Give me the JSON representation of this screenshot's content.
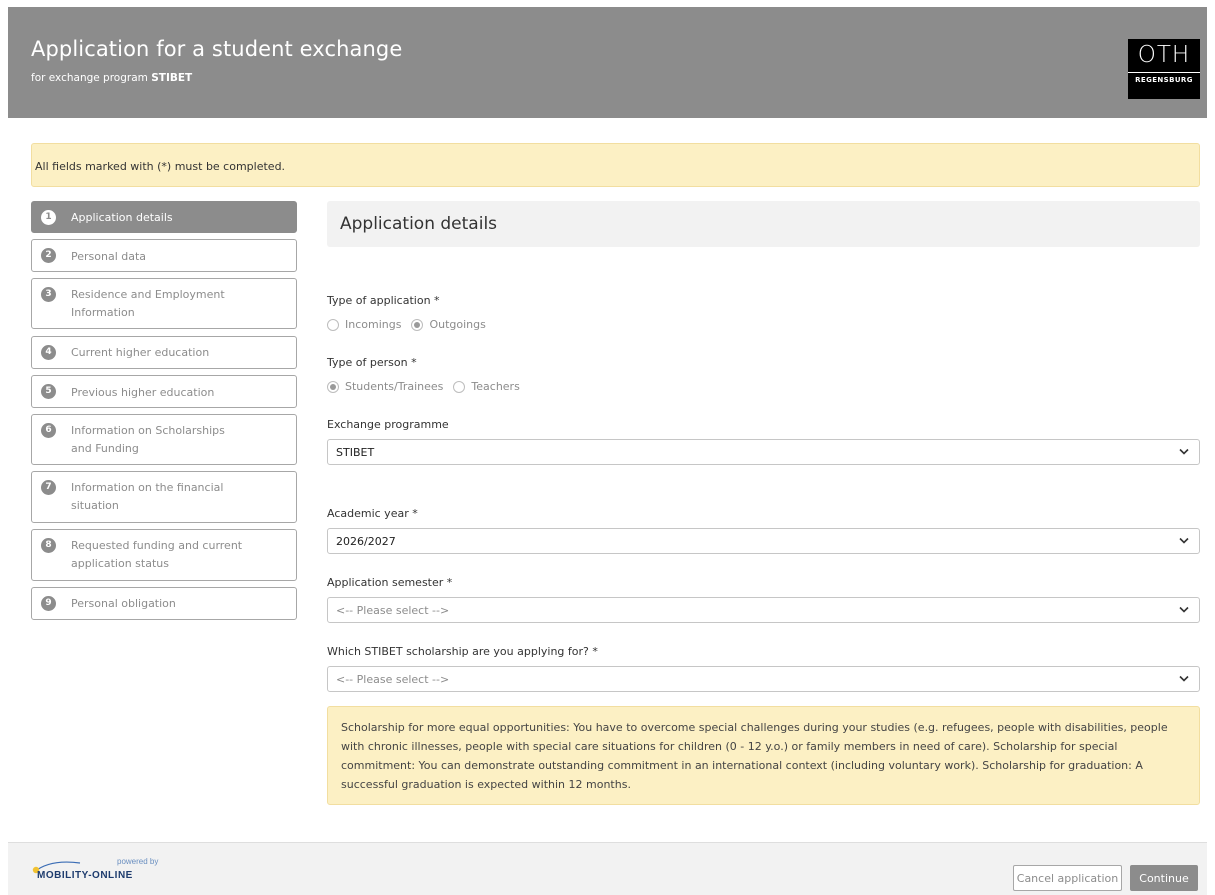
{
  "header": {
    "title": "Application for a student exchange",
    "subtitle_prefix": "for exchange program ",
    "subtitle_program": "STIBET",
    "logo_main": "OTH",
    "logo_sub": "REGENSBURG"
  },
  "notice": "All fields marked with (*) must be completed.",
  "steps": [
    {
      "num": "1",
      "label": "Application details",
      "active": true
    },
    {
      "num": "2",
      "label": "Personal data"
    },
    {
      "num": "3",
      "label_line1": "Residence and Employment",
      "label_line2": "Information"
    },
    {
      "num": "4",
      "label": "Current higher education"
    },
    {
      "num": "5",
      "label": "Previous higher education"
    },
    {
      "num": "6",
      "label_line1": "Information on Scholarships",
      "label_line2": "and Funding"
    },
    {
      "num": "7",
      "label_line1": "Information on the financial",
      "label_line2": "situation"
    },
    {
      "num": "8",
      "label_line1": "Requested funding and current",
      "label_line2": "application status"
    },
    {
      "num": "9",
      "label": "Personal obligation"
    }
  ],
  "panel_title": "Application details",
  "form": {
    "type_of_application": {
      "label": "Type of application *",
      "options": [
        {
          "label": "Incomings",
          "checked": false
        },
        {
          "label": "Outgoings",
          "checked": true
        }
      ]
    },
    "type_of_person": {
      "label": "Type of person *",
      "options": [
        {
          "label": "Students/Trainees",
          "checked": true
        },
        {
          "label": "Teachers",
          "checked": false
        }
      ]
    },
    "exchange_programme": {
      "label": "Exchange programme",
      "value": "STIBET"
    },
    "academic_year": {
      "label": "Academic year *",
      "value": "2026/2027"
    },
    "application_semester": {
      "label": "Application semester *",
      "value": "<-- Please select -->"
    },
    "scholarship": {
      "label": "Which STIBET scholarship are you applying for? *",
      "value": "<-- Please select -->"
    }
  },
  "info_text": "Scholarship for more equal opportunities: You have to overcome special challenges during your studies (e.g. refugees, people with disabilities, people with chronic illnesses, people with special care situations for children (0 - 12 y.o.) or family members in need of care). Scholarship for special commitment: You can demonstrate outstanding commitment in an international context (including voluntary work). Scholarship for graduation: A successful graduation is expected within 12 months.",
  "footer": {
    "powered_by": "powered by",
    "brand": "MOBILITY-ONLINE",
    "cancel_label": "Cancel application",
    "continue_label": "Continue"
  },
  "colors": {
    "header_bg": "#8c8c8c",
    "notice_bg": "#fcf0c4",
    "active_step_bg": "#8c8c8c"
  }
}
